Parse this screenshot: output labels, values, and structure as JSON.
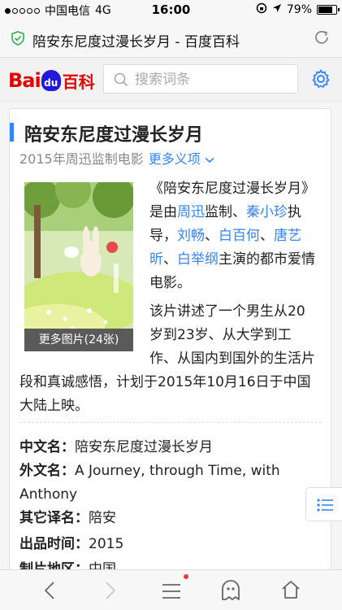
{
  "status": {
    "carrier": "中国电信",
    "network": "4G",
    "time": "16:00",
    "battery": "79%"
  },
  "browser": {
    "page_title": "陪安东尼度过漫长岁月 - 百度百科"
  },
  "header": {
    "logo_bai": "Bai",
    "logo_du": "du",
    "logo_baike": "百科",
    "search_placeholder": "搜索词条"
  },
  "entry": {
    "title": "陪安东尼度过漫长岁月",
    "subtitle": "2015年周迅监制电影",
    "more_meanings": "更多义项",
    "more_images": "更多图片(24张)",
    "intro": {
      "t1": "《陪安东尼度过漫长岁月》是由",
      "producer": "周迅",
      "t2": "监制、",
      "director": "秦小珍",
      "t3": "执导，",
      "actors": [
        "刘畅",
        "白百何",
        "唐艺昕",
        "白举纲"
      ],
      "sep": "、",
      "t4": "主演的都市爱情电影。"
    },
    "synopsis_a": "该片讲述了一个男生从20岁到23岁、从大学到工作、从国内到国外的生活片",
    "synopsis_b": "段和真诚感悟，计划于2015年10月16日于中国大陆上映。",
    "info": [
      {
        "key": "中文名：",
        "value": "陪安东尼度过漫长岁月"
      },
      {
        "key": "外文名：",
        "value": "A Journey, through Time, with Anthony"
      },
      {
        "key": "其它译名：",
        "value": "陪安"
      },
      {
        "key": "出品时间：",
        "value": "2015"
      },
      {
        "key": "制片地区：",
        "value": "中国"
      }
    ]
  },
  "colors": {
    "accent": "#3385ff",
    "brand_red": "#e10601"
  }
}
